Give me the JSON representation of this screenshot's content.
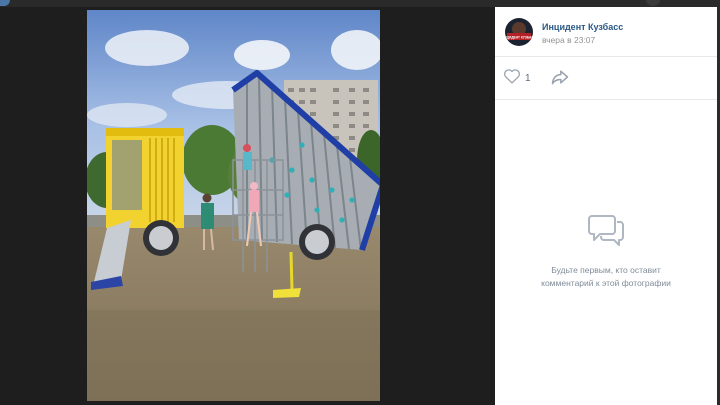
{
  "author": {
    "name": "Инцидент Кузбасс",
    "time": "вчера в 23:07",
    "avatar_text": "ИНЦИДЕНТ КУЗБАСС"
  },
  "actions": {
    "likes_count": "1"
  },
  "comments": {
    "empty_line1": "Будьте первым, кто оставит",
    "empty_line2": "комментарий к этой фотографии"
  },
  "colors": {
    "link": "#2a5885",
    "muted": "#818c99",
    "overlay": "#1f1f1f",
    "panel": "#ffffff"
  },
  "icons": [
    "heart-icon",
    "share-icon",
    "comment-bubbles-icon"
  ]
}
